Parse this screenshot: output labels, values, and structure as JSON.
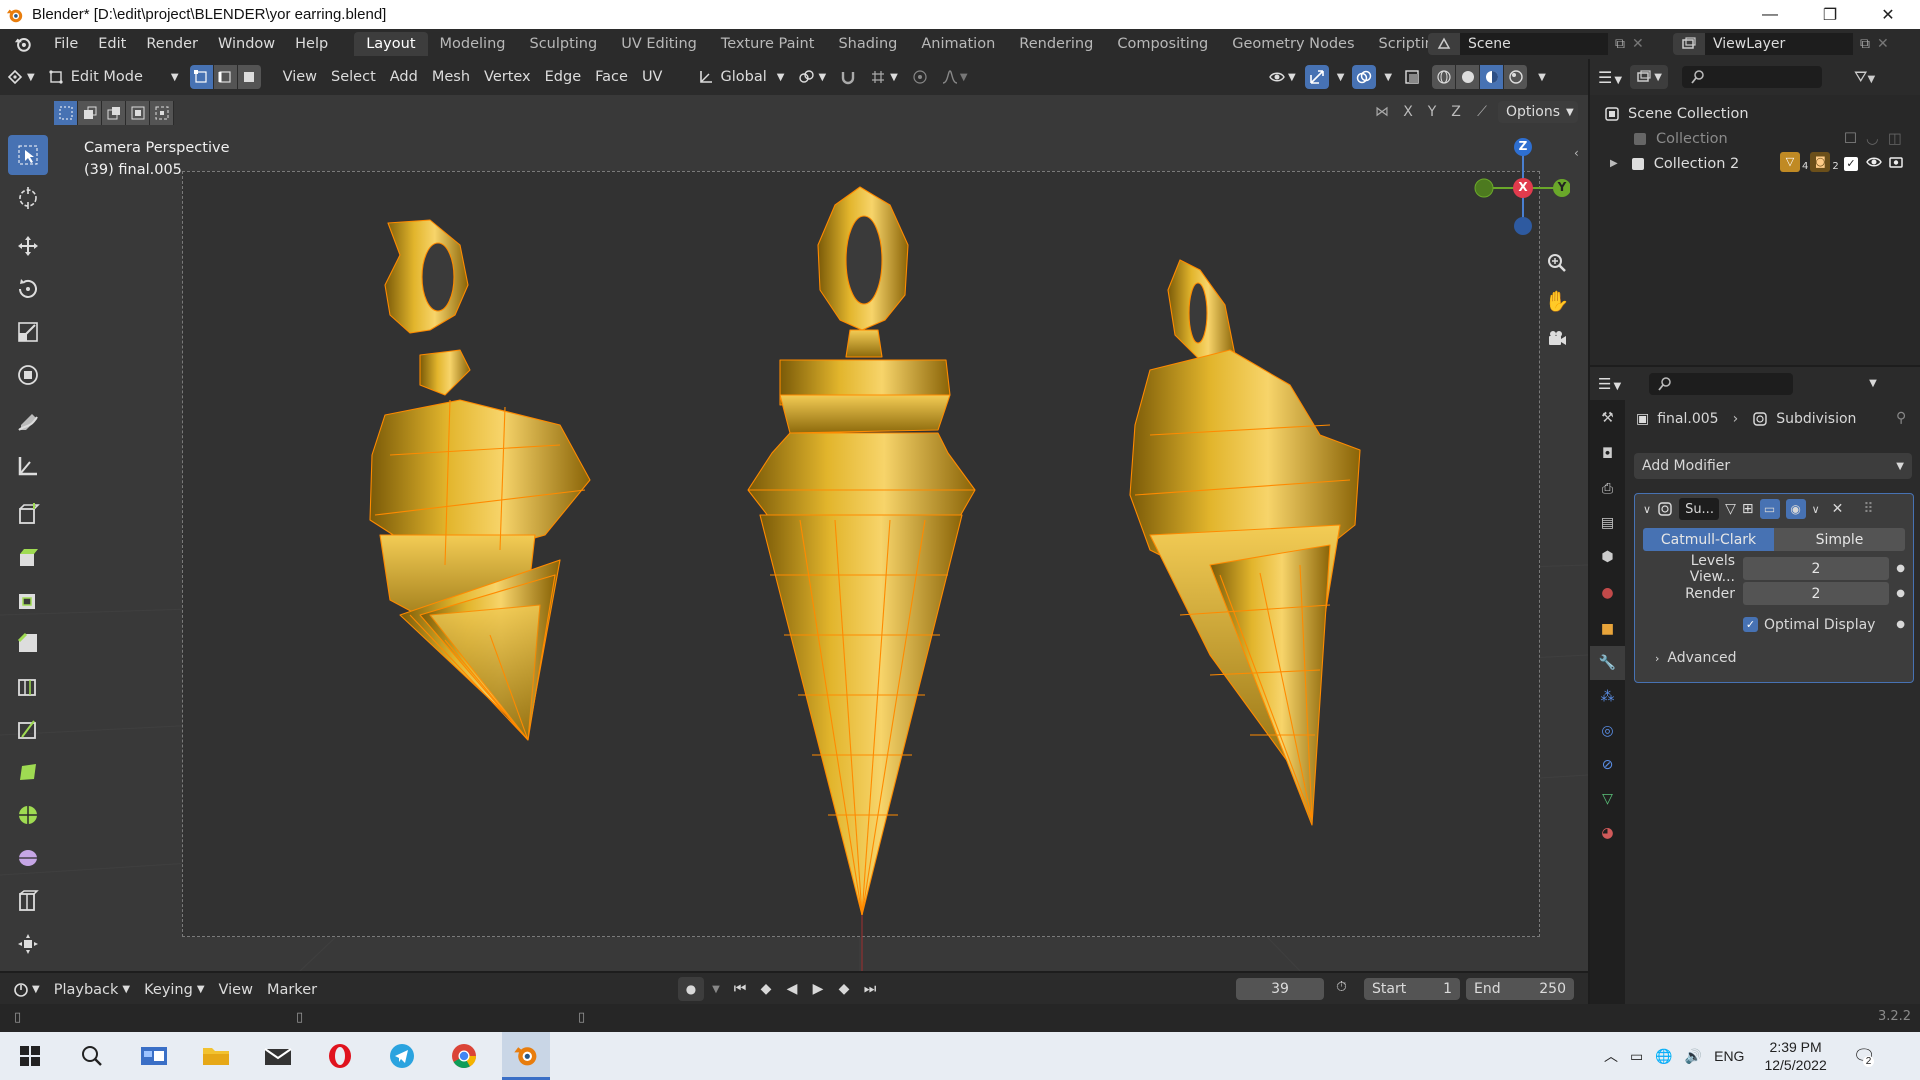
{
  "window": {
    "title": "Blender* [D:\\edit\\project\\BLENDER\\yor earring.blend]",
    "minimize": "—",
    "maximize": "❐",
    "close": "✕"
  },
  "menu": [
    "File",
    "Edit",
    "Render",
    "Window",
    "Help"
  ],
  "workspaces": [
    "Layout",
    "Modeling",
    "Sculpting",
    "UV Editing",
    "Texture Paint",
    "Shading",
    "Animation",
    "Rendering",
    "Compositing",
    "Geometry Nodes",
    "Scripting"
  ],
  "workspace_active": "Layout",
  "workspace_add": "+",
  "scene": "Scene",
  "view_layer": "ViewLayer",
  "header": {
    "mode": "Edit Mode",
    "menus": [
      "View",
      "Select",
      "Add",
      "Mesh",
      "Vertex",
      "Edge",
      "Face",
      "UV"
    ],
    "transform_orientation": "Global",
    "options": "Options",
    "axes": [
      "X",
      "Y",
      "Z"
    ]
  },
  "viewport": {
    "perspective": "Camera Perspective",
    "object": "(39) final.005",
    "gizmo": {
      "z": "Z",
      "x": "X",
      "y": "Y"
    }
  },
  "outliner": {
    "scene_collection": "Scene Collection",
    "rows": [
      {
        "label": "Collection"
      },
      {
        "label": "Collection 2",
        "badge1": "4",
        "badge2": "2"
      }
    ]
  },
  "properties": {
    "object": "final.005",
    "modifier_name": "Subdivision",
    "add_modifier": "Add Modifier",
    "modifier_short": "Su...",
    "method_catmull": "Catmull-Clark",
    "method_simple": "Simple",
    "levels_label": "Levels View...",
    "levels_value": "2",
    "render_label": "Render",
    "render_value": "2",
    "optimal_display": "Optimal Display",
    "advanced": "Advanced"
  },
  "timeline": {
    "menus": [
      "Playback",
      "Keying",
      "View",
      "Marker"
    ],
    "current_frame": "39",
    "start_label": "Start",
    "start": "1",
    "end_label": "End",
    "end": "250"
  },
  "status": {
    "version": "3.2.2"
  },
  "taskbar": {
    "lang": "ENG",
    "time": "2:39 PM",
    "date": "12/5/2022",
    "notifications": "2"
  },
  "colors": {
    "accent": "#4772b3",
    "gold": "#d4a21c",
    "vertex": "#ff8a00"
  }
}
